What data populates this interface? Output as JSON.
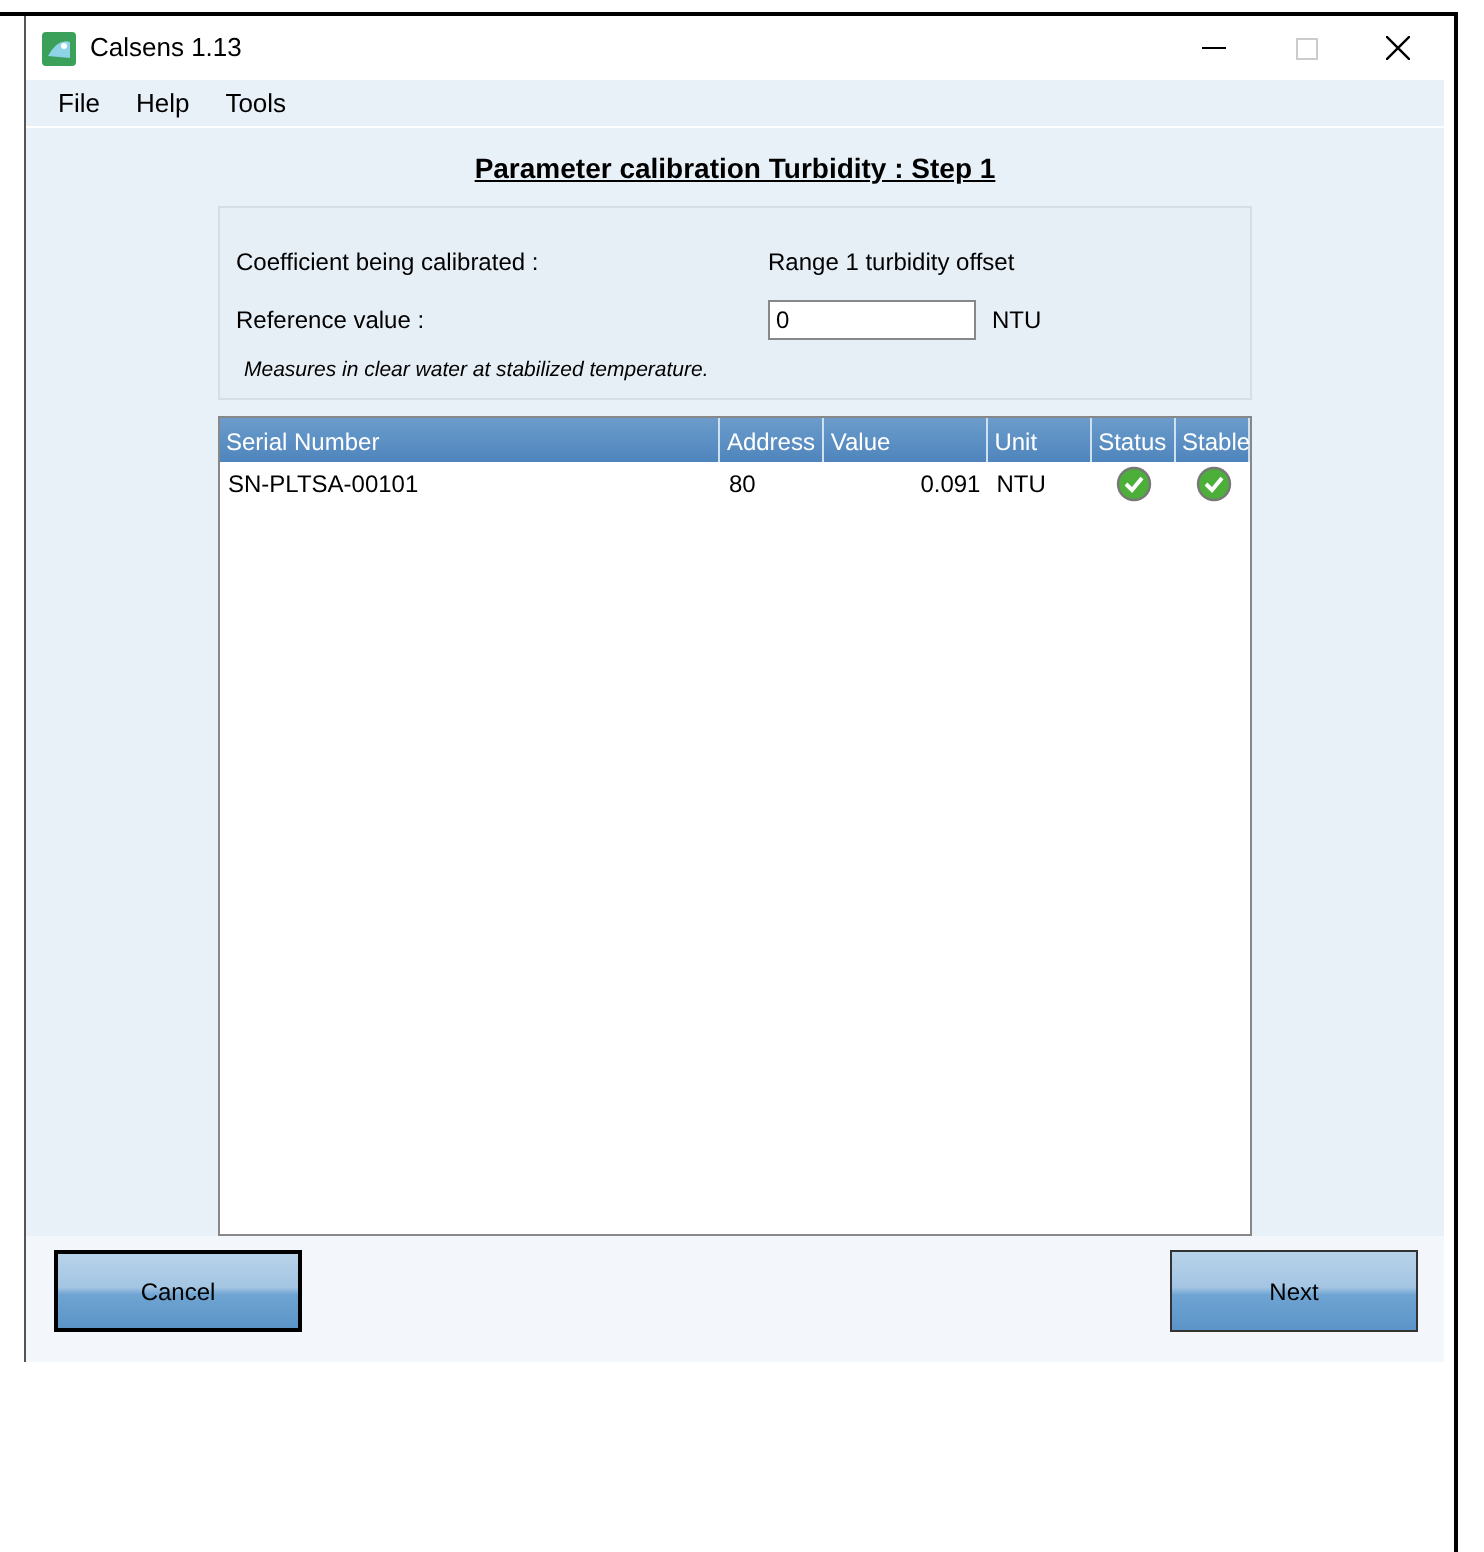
{
  "window": {
    "title": "Calsens 1.13"
  },
  "menu": [
    "File",
    "Help",
    "Tools"
  ],
  "heading": "Parameter calibration Turbidity :  Step 1",
  "form": {
    "coefficient_label": "Coefficient being calibrated :",
    "coefficient_value": "Range 1 turbidity offset",
    "reference_label": "Reference value :",
    "reference_value": "0",
    "reference_unit": "NTU",
    "note": "Measures in clear water at stabilized temperature."
  },
  "table": {
    "columns": [
      "Serial Number",
      "Address",
      "Value",
      "Unit",
      "Status",
      "Stable"
    ],
    "rows": [
      {
        "serial": "SN-PLTSA-00101",
        "address": "80",
        "value": "0.091",
        "unit": "NTU",
        "status_ok": true,
        "stable": true
      }
    ]
  },
  "buttons": [
    {
      "label": "Cancel",
      "focused": true
    },
    {
      "label": "Next",
      "focused": false
    }
  ]
}
